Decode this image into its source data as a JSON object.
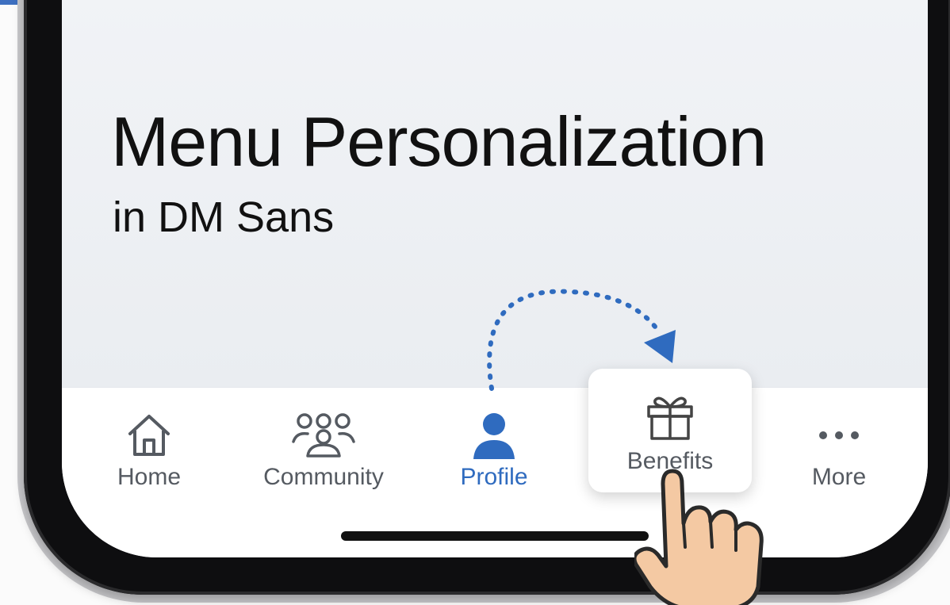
{
  "colors": {
    "accent": "#2f6bbf",
    "tab_label": "#555a61",
    "title": "#111111"
  },
  "header": {
    "title": "Menu Personalization",
    "subtitle": "in DM Sans"
  },
  "tabbar": {
    "tabs": [
      {
        "label": "Home",
        "icon": "home-icon"
      },
      {
        "label": "Community",
        "icon": "community-icon"
      },
      {
        "label": "Profile",
        "icon": "profile-icon",
        "active": true
      },
      {
        "label": "Benefits",
        "icon": "gift-icon",
        "lifted": true
      },
      {
        "label": "More",
        "icon": "more-dots-icon"
      }
    ]
  }
}
